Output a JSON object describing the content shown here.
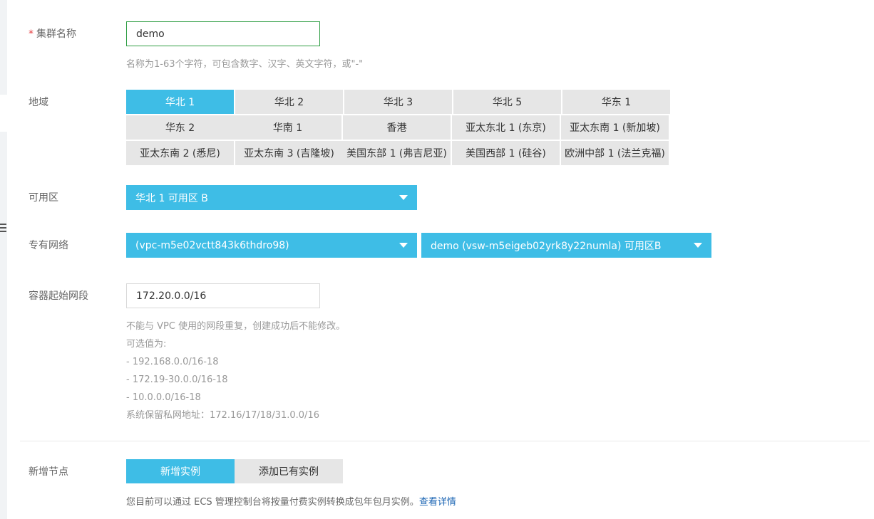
{
  "cluster_name": {
    "required_mark": "*",
    "label": "集群名称",
    "value": "demo",
    "help": "名称为1-63个字符，可包含数字、汉字、英文字符，或\"-\""
  },
  "region": {
    "label": "地域",
    "options": [
      "华北 1",
      "华北 2",
      "华北 3",
      "华北 5",
      "华东 1",
      "华东 2",
      "华南 1",
      "香港",
      "亚太东北 1 (东京)",
      "亚太东南 1 (新加坡)",
      "亚太东南 2 (悉尼)",
      "亚太东南 3 (吉隆坡)",
      "美国东部 1 (弗吉尼亚)",
      "美国西部 1 (硅谷)",
      "欧洲中部 1 (法兰克福)"
    ],
    "selected": "华北 1"
  },
  "zone": {
    "label": "可用区",
    "value": "华北 1 可用区 B"
  },
  "vpc": {
    "label": "专有网络",
    "vpc_value": "(vpc-m5e02vctt843k6thdro98)",
    "vswitch_value": "demo (vsw-m5eigeb02yrk8y22numla) 可用区B"
  },
  "container_cidr": {
    "label": "容器起始网段",
    "value": "172.20.0.0/16",
    "help_lines": [
      "不能与 VPC 使用的网段重复，创建成功后不能修改。",
      "可选值为:",
      "- 192.168.0.0/16-18",
      "- 172.19-30.0.0/16-18",
      "- 10.0.0.0/16-18",
      "系统保留私网地址：172.16/17/18/31.0.0/16"
    ]
  },
  "add_node": {
    "label": "新增节点",
    "tab_new": "新增实例",
    "tab_existing": "添加已有实例",
    "selected": "新增实例",
    "help_text": "您目前可以通过 ECS 管理控制台将按量付费实例转换成包年包月实例。",
    "help_link": "查看详情"
  },
  "colors": {
    "accent": "#3ebde6",
    "inactive_button": "#e6e6e6",
    "required": "#e4393c",
    "link": "#1a64b3",
    "focus_border": "#2f9e44"
  }
}
